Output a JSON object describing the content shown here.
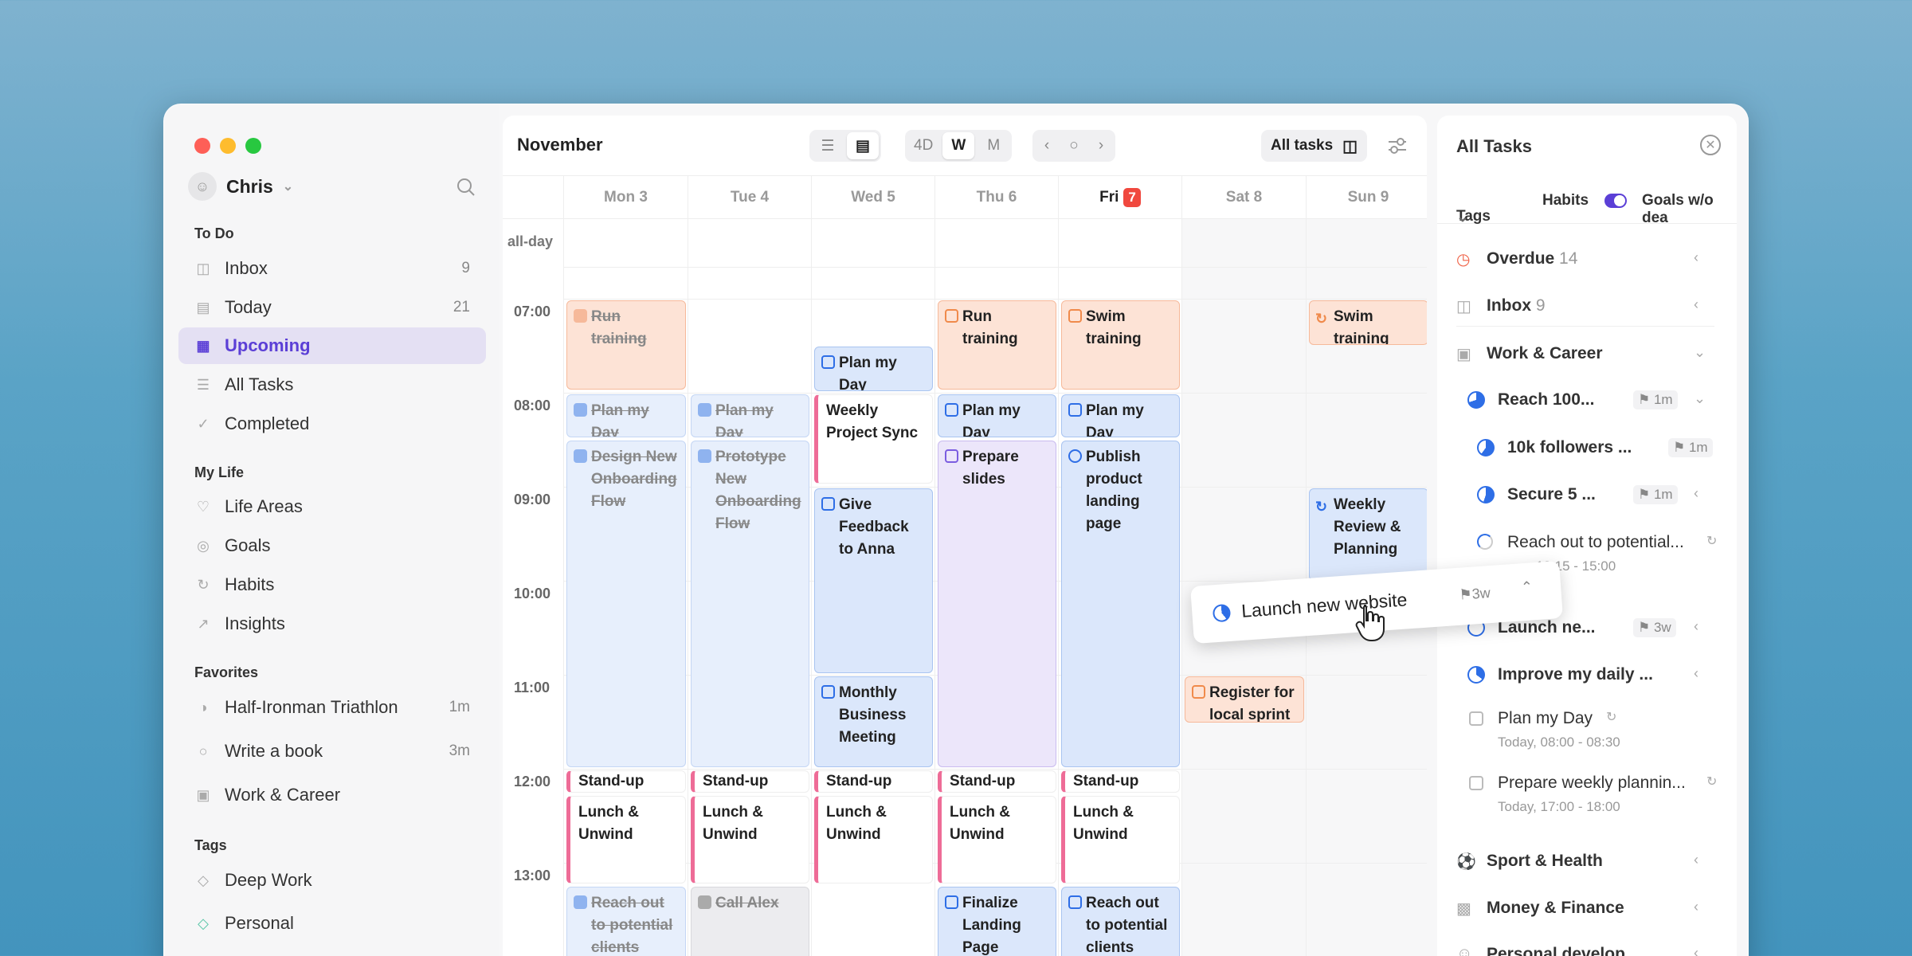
{
  "user": {
    "name": "Chris"
  },
  "sidebar": {
    "sections": {
      "todo": "To Do",
      "mylife": "My Life",
      "favorites": "Favorites",
      "tags": "Tags"
    },
    "todo": [
      {
        "label": "Inbox",
        "count": "9"
      },
      {
        "label": "Today",
        "count": "21"
      },
      {
        "label": "Upcoming",
        "count": ""
      },
      {
        "label": "All Tasks",
        "count": ""
      },
      {
        "label": "Completed",
        "count": ""
      }
    ],
    "mylife": [
      {
        "label": "Life Areas"
      },
      {
        "label": "Goals"
      },
      {
        "label": "Habits"
      },
      {
        "label": "Insights"
      }
    ],
    "favorites": [
      {
        "label": "Half-Ironman Triathlon",
        "count": "1m"
      },
      {
        "label": "Write a book",
        "count": "3m"
      },
      {
        "label": "Work & Career",
        "count": ""
      }
    ],
    "tags": [
      {
        "label": "Deep Work"
      },
      {
        "label": "Personal"
      }
    ]
  },
  "calendar": {
    "month": "November",
    "views": [
      "4D",
      "W",
      "M"
    ],
    "all_tasks_label": "All tasks",
    "allday_label": "all-day",
    "days": [
      {
        "label": "Mon 3"
      },
      {
        "label": "Tue 4"
      },
      {
        "label": "Wed 5"
      },
      {
        "label": "Thu 6"
      },
      {
        "label": "Fri",
        "badge": "7"
      },
      {
        "label": "Sat 8"
      },
      {
        "label": "Sun 9"
      }
    ],
    "times": [
      "07:00",
      "08:00",
      "09:00",
      "10:00",
      "11:00",
      "12:00",
      "13:00"
    ],
    "events": {
      "mon_run": "Run training",
      "mon_plan": "Plan my Day",
      "mon_design": "Design New Onboarding Flow",
      "mon_standup": "Stand-up",
      "mon_lunch": "Lunch & Unwind",
      "mon_reach": "Reach out to potential clients",
      "tue_plan": "Plan my Day",
      "tue_proto": "Prototype New Onboarding Flow",
      "tue_standup": "Stand-up",
      "tue_lunch": "Lunch & Unwind",
      "tue_call": "Call Alex",
      "wed_plan": "Plan my Day",
      "wed_weekly": "Weekly Project Sync",
      "wed_feedback": "Give Feedback to Anna",
      "wed_monthly": "Monthly Business Meeting",
      "wed_standup": "Stand-up",
      "wed_lunch": "Lunch & Unwind",
      "thu_run": "Run training",
      "thu_plan": "Plan my Day",
      "thu_slides": "Prepare slides",
      "thu_standup": "Stand-up",
      "thu_lunch": "Lunch & Unwind",
      "thu_finalize": "Finalize Landing Page",
      "fri_swim": "Swim training",
      "fri_plan": "Plan my Day",
      "fri_publish": "Publish product landing page",
      "fri_standup": "Stand-up",
      "fri_lunch": "Lunch & Unwind",
      "fri_reach": "Reach out to potential clients",
      "sat_register": "Register for local sprint",
      "sun_swim": "Swim training",
      "sun_weekly": "Weekly Review & Planning"
    }
  },
  "panel": {
    "title": "All Tasks",
    "filters": {
      "tags": "Tags",
      "habits": "Habits",
      "goals": "Goals w/o dea"
    },
    "overdue": {
      "label": "Overdue",
      "count": "14"
    },
    "inbox": {
      "label": "Inbox",
      "count": "9"
    },
    "work": {
      "label": "Work & Career"
    },
    "reach": {
      "label": "Reach 100...",
      "flag": "1m"
    },
    "followers": {
      "label": "10k followers ...",
      "flag": "1m"
    },
    "secure": {
      "label": "Secure 5 ...",
      "flag": "1m"
    },
    "reachout": {
      "label": "Reach out to potential...",
      "time": "13:15 - 15:00"
    },
    "launch": {
      "label": "Launch ne...",
      "flag": "3w"
    },
    "improve": {
      "label": "Improve my daily ..."
    },
    "planday": {
      "label": "Plan my Day",
      "time": "Today, 08:00 - 08:30"
    },
    "prepare": {
      "label": "Prepare weekly plannin...",
      "time": "Today, 17:00 - 18:00"
    },
    "sport": {
      "label": "Sport & Health"
    },
    "money": {
      "label": "Money & Finance"
    },
    "personal": {
      "label": "Personal develop..."
    }
  },
  "drag": {
    "label": "Launch new website",
    "flag": "3w"
  }
}
